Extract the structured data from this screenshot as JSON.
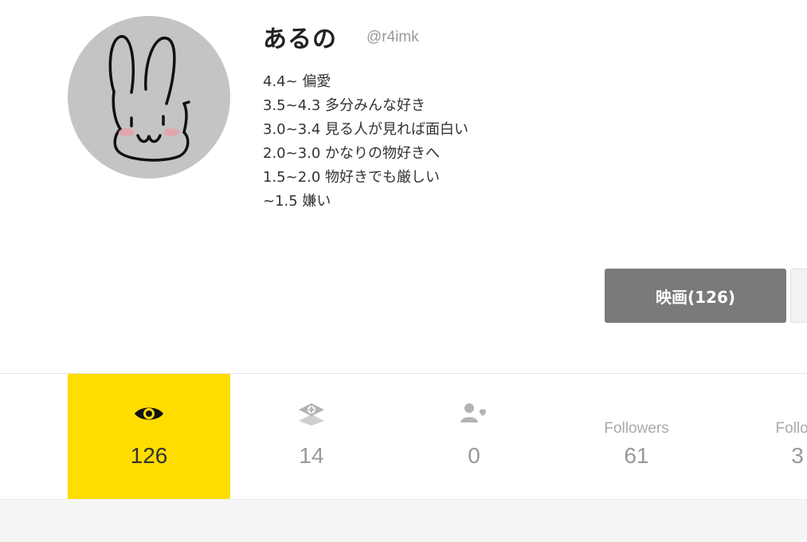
{
  "profile": {
    "name": "あるの",
    "handle": "@r4imk",
    "bio": [
      "4.4~ 偏愛",
      "3.5~4.3 多分みんな好き",
      "3.0~3.4 見る人が見れば面白い",
      "2.0~3.0 かなりの物好きへ",
      "1.5~2.0 物好きでも厳しい",
      "~1.5 嫌い"
    ]
  },
  "category_tabs": {
    "movies_label": "映画(126)"
  },
  "stats": {
    "watched": {
      "icon": "eye-icon",
      "value": "126"
    },
    "clips": {
      "icon": "film-plus-icon",
      "value": "14"
    },
    "fans": {
      "icon": "user-heart-icon",
      "value": "0"
    },
    "followers": {
      "label": "Followers",
      "value": "61"
    },
    "following": {
      "label": "Follow",
      "value": "3"
    }
  },
  "colors": {
    "active_tab": "#ffdd00",
    "category_tab_bg": "#7a7a7a",
    "avatar_bg": "#c4c4c4"
  }
}
